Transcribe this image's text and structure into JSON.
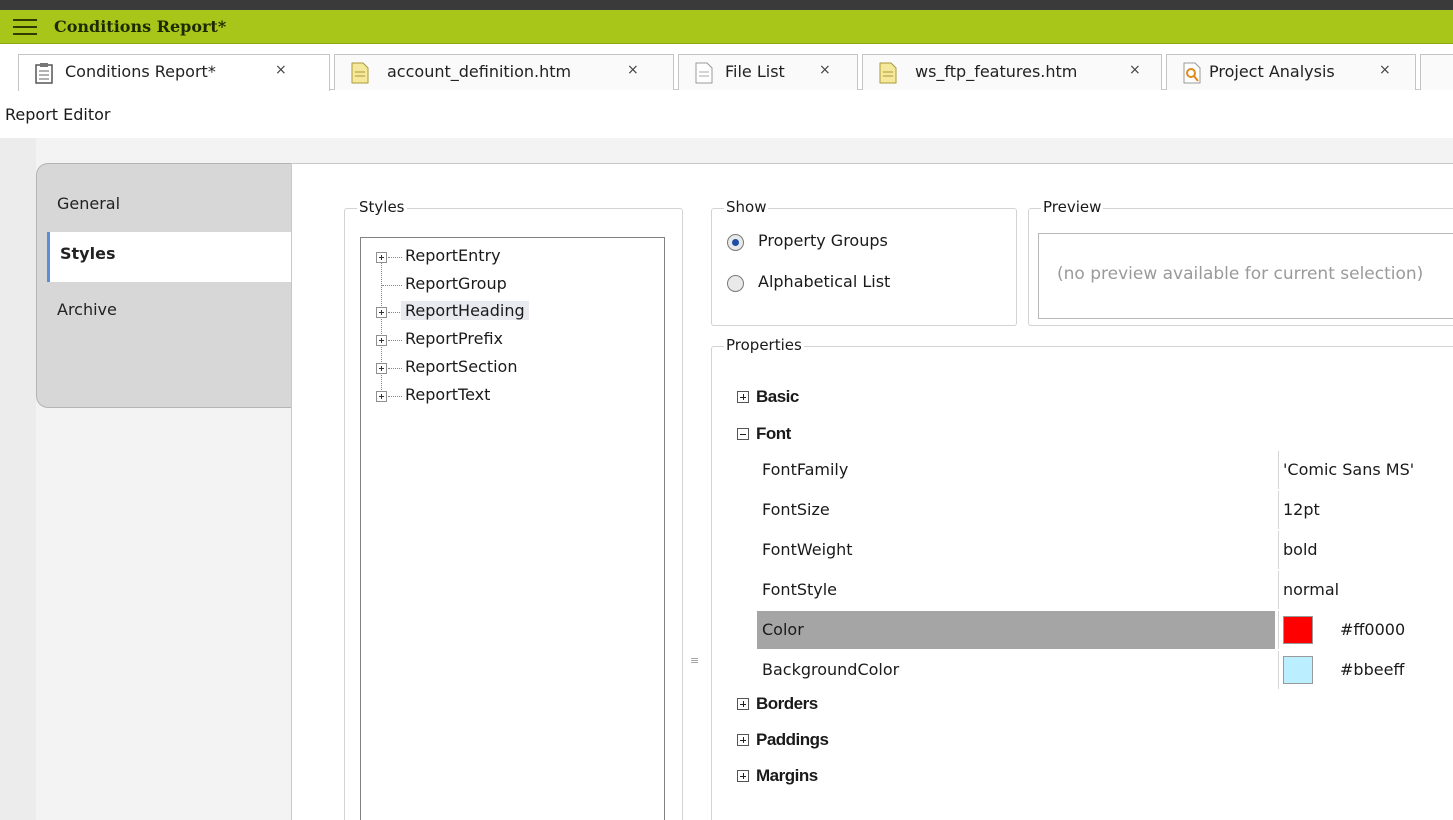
{
  "app": {
    "title": "Conditions Report*"
  },
  "tabs": [
    {
      "label": "Conditions Report*",
      "icon": "clipboard-icon",
      "close": "×"
    },
    {
      "label": "account_definition.htm",
      "icon": "html-file-icon",
      "close": "×"
    },
    {
      "label": "File List",
      "icon": "document-icon",
      "close": "×"
    },
    {
      "label": "ws_ftp_features.htm",
      "icon": "html-file-icon",
      "close": "×"
    },
    {
      "label": "Project Analysis",
      "icon": "analysis-icon",
      "close": "×"
    }
  ],
  "editor": {
    "title": "Report Editor"
  },
  "side_tabs": [
    "General",
    "Styles",
    "Archive"
  ],
  "styles_panel": {
    "title": "Styles",
    "items": [
      "ReportEntry",
      "ReportGroup",
      "ReportHeading",
      "ReportPrefix",
      "ReportSection",
      "ReportText"
    ],
    "selected": "ReportHeading"
  },
  "show_panel": {
    "title": "Show",
    "options": [
      "Property Groups",
      "Alphabetical List"
    ],
    "selected": "Property Groups"
  },
  "preview_panel": {
    "title": "Preview",
    "text": "(no preview available for current selection)"
  },
  "properties_panel": {
    "title": "Properties",
    "groups_top": [
      "Basic",
      "Font"
    ],
    "font_props": [
      {
        "key": "FontFamily",
        "value": "'Comic Sans MS'"
      },
      {
        "key": "FontSize",
        "value": "12pt"
      },
      {
        "key": "FontWeight",
        "value": "bold"
      },
      {
        "key": "FontStyle",
        "value": "normal"
      },
      {
        "key": "Color",
        "value": "#ff0000",
        "swatch": "#ff0000"
      },
      {
        "key": "BackgroundColor",
        "value": "#bbeeff",
        "swatch": "#bbeeff"
      }
    ],
    "selected_prop": "Color",
    "groups_bottom": [
      "Borders",
      "Paddings",
      "Margins"
    ]
  },
  "colors": {
    "titlebar": "#a8c61a",
    "selected_row": "#a5a5a5",
    "accent": "#1b4fa8"
  }
}
